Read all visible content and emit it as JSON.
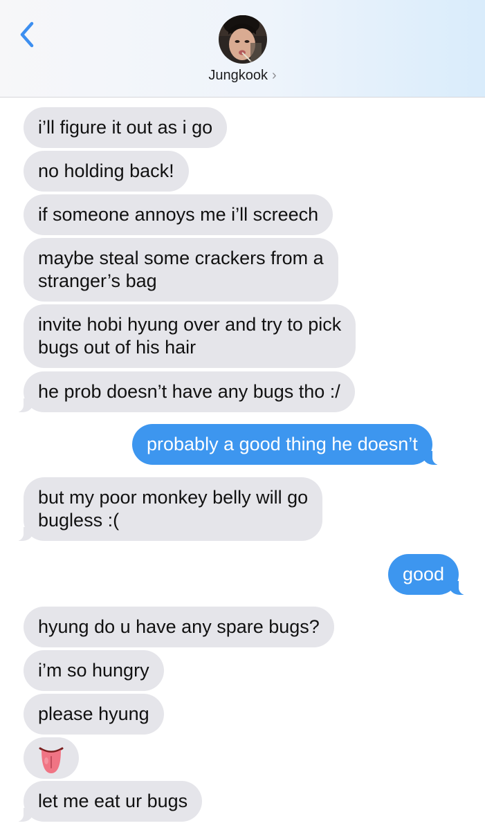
{
  "header": {
    "contact_name": "Jungkook",
    "chevron": "›",
    "back_icon": "chevron-left-icon",
    "accent_color": "#3d96ef"
  },
  "messages": [
    {
      "sender": "contact",
      "text": "i’ll figure it out as i go"
    },
    {
      "sender": "contact",
      "text": "no holding back!"
    },
    {
      "sender": "contact",
      "text": "if someone annoys me i’ll screech"
    },
    {
      "sender": "contact",
      "lines": [
        "maybe steal some crackers from a",
        "stranger’s bag"
      ]
    },
    {
      "sender": "contact",
      "lines": [
        "invite hobi hyung over and try to pick",
        "bugs out of his hair"
      ]
    },
    {
      "sender": "contact",
      "text": "he prob doesn’t have any bugs tho :/"
    },
    {
      "sender": "me",
      "text": "probably a good thing he doesn’t"
    },
    {
      "sender": "contact",
      "lines": [
        "but my poor monkey belly will go",
        "bugless  :("
      ]
    },
    {
      "sender": "me",
      "text": "good"
    },
    {
      "sender": "contact",
      "text": "hyung do u have any spare bugs?"
    },
    {
      "sender": "contact",
      "text": "i’m so hungry"
    },
    {
      "sender": "contact",
      "text": "please hyung"
    },
    {
      "sender": "contact",
      "emoji": "tongue-emoji"
    },
    {
      "sender": "contact",
      "text": "let me eat ur bugs"
    }
  ],
  "colors": {
    "incoming_bubble": "#e5e5ea",
    "outgoing_bubble": "#3d96ef"
  }
}
